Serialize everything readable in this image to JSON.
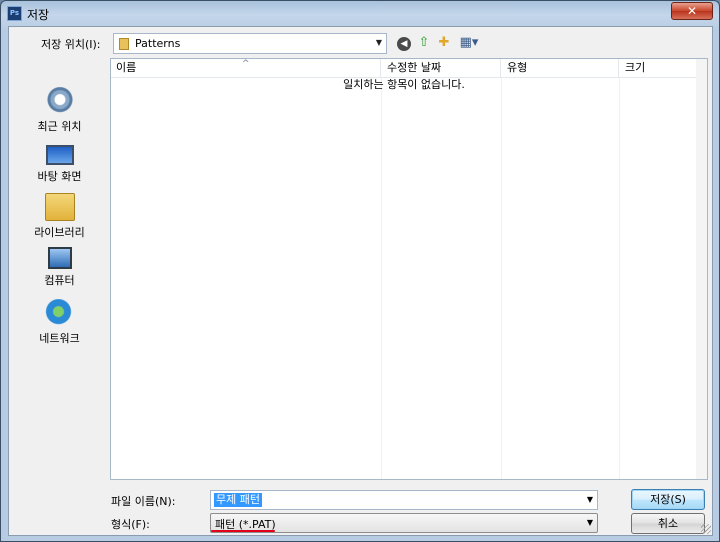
{
  "window": {
    "title": "저장",
    "app_icon": "Ps",
    "close_glyph": "✕"
  },
  "toolbar": {
    "save_in_label": "저장 위치(I):",
    "location": "Patterns",
    "combo_arrow": "▼",
    "back_glyph": "◀",
    "up_glyph": "⇧",
    "newfolder_glyph": "✚",
    "views_glyph": "▦▾"
  },
  "places": [
    {
      "label": "최근 위치",
      "icon": "recent-places-icon"
    },
    {
      "label": "바탕 화면",
      "icon": "desktop-icon"
    },
    {
      "label": "라이브러리",
      "icon": "library-icon"
    },
    {
      "label": "컴퓨터",
      "icon": "computer-icon"
    },
    {
      "label": "네트워크",
      "icon": "network-icon"
    }
  ],
  "filelist": {
    "columns": [
      "이름",
      "수정한 날짜",
      "유형",
      "크기"
    ],
    "sort_glyph": "^",
    "empty_message": "일치하는 항목이 없습니다."
  },
  "form": {
    "filename_label": "파일 이름(N):",
    "filename_value": "무제 패턴",
    "filetype_label": "형식(F):",
    "filetype_value": "패턴 (*.PAT)",
    "arrow": "▼"
  },
  "buttons": {
    "save": "저장(S)",
    "cancel": "취소"
  },
  "colors": {
    "selection": "#3399ff",
    "annotation_underline": "#e2001a",
    "close_button": "#c7452a"
  }
}
